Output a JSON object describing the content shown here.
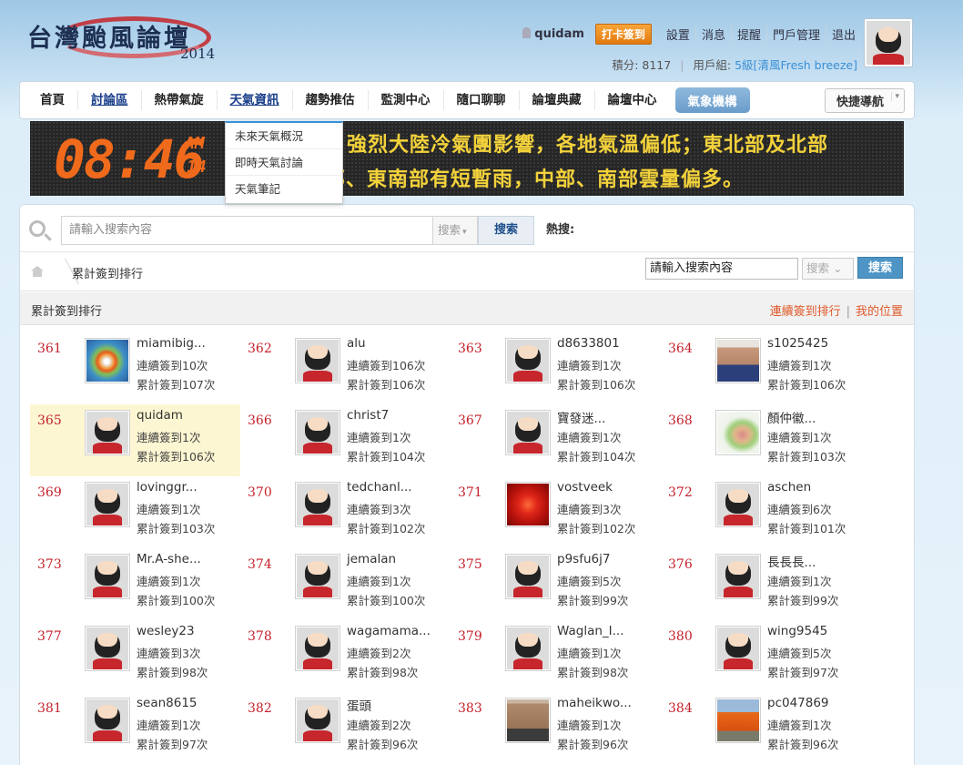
{
  "site": {
    "title": "台灣颱風論壇",
    "year": "2014"
  },
  "usermenu": {
    "username": "quidam",
    "checkin": "打卡簽到",
    "links": [
      "設置",
      "消息",
      "提醒",
      "門戶管理",
      "退出"
    ]
  },
  "userstats": {
    "points_label": "積分: 8117",
    "group_label": "用戶組:",
    "group_value": "5級[清風Fresh breeze]"
  },
  "nav": {
    "items": [
      "首頁",
      "討論區",
      "熱帶氣旋",
      "天氣資訊",
      "趨勢推估",
      "監測中心",
      "隨口聊聊",
      "論壇典藏",
      "論壇中心"
    ],
    "weather_button": "氣象機構",
    "quick_nav": "快捷導航"
  },
  "dropdown": {
    "items": [
      "未來天氣概況",
      "即時天氣討論",
      "天氣筆記"
    ]
  },
  "ticker": {
    "time": "08:46",
    "ampm": "AM",
    "day": "14",
    "line1": "強烈大陸冷氣團影響，各地氣溫偏低；東北部及北部",
    "line2": "部、東南部有短暫雨，中部、南部雲量偏多。"
  },
  "search": {
    "placeholder": "請輸入搜索內容",
    "select": "搜索",
    "button": "搜索",
    "hot": "熱搜:"
  },
  "breadcrumb": {
    "current": "累計簽到排行",
    "search_value": "請輸入搜索內容",
    "select": "搜索",
    "button": "搜索"
  },
  "section": {
    "title": "累計簽到排行",
    "link1": "連續簽到排行",
    "sep": "|",
    "link2": "我的位置"
  },
  "colors": {
    "accent": "#3a8fd6",
    "rank": "#c4202a",
    "highlight": "#fdf6d2",
    "ticker_text": "#f3d23b",
    "clock": "#f06a1c"
  },
  "ranking": [
    {
      "rank": "361",
      "name": "miamibig...",
      "streak": "連續簽到10次",
      "total": "累計簽到107次",
      "avatar": "hurricane-avatar"
    },
    {
      "rank": "362",
      "name": "alu",
      "streak": "連續簽到106次",
      "total": "累計簽到106次",
      "avatar": "default-avatar"
    },
    {
      "rank": "363",
      "name": "d8633801",
      "streak": "連續簽到1次",
      "total": "累計簽到106次",
      "avatar": "default-avatar"
    },
    {
      "rank": "364",
      "name": "s1025425",
      "streak": "連續簽到1次",
      "total": "累計簽到106次",
      "avatar": "photo-avatar"
    },
    {
      "rank": "365",
      "name": "quidam",
      "streak": "連續簽到1次",
      "total": "累計簽到106次",
      "avatar": "default-avatar"
    },
    {
      "rank": "366",
      "name": "christ7",
      "streak": "連續簽到1次",
      "total": "累計簽到104次",
      "avatar": "default-avatar"
    },
    {
      "rank": "367",
      "name": "寶發迷...",
      "streak": "連續簽到1次",
      "total": "累計簽到104次",
      "avatar": "default-avatar"
    },
    {
      "rank": "368",
      "name": "顏仲徽...",
      "streak": "連續簽到1次",
      "total": "累計簽到103次",
      "avatar": "map-avatar"
    },
    {
      "rank": "369",
      "name": "lovinggr...",
      "streak": "連續簽到1次",
      "total": "累計簽到103次",
      "avatar": "default-avatar"
    },
    {
      "rank": "370",
      "name": "tedchanl...",
      "streak": "連續簽到3次",
      "total": "累計簽到102次",
      "avatar": "default-avatar"
    },
    {
      "rank": "371",
      "name": "vostveek",
      "streak": "連續簽到3次",
      "total": "累計簽到102次",
      "avatar": "flower-avatar"
    },
    {
      "rank": "372",
      "name": "aschen",
      "streak": "連續簽到6次",
      "total": "累計簽到101次",
      "avatar": "default-avatar"
    },
    {
      "rank": "373",
      "name": "Mr.A-she...",
      "streak": "連續簽到1次",
      "total": "累計簽到100次",
      "avatar": "default-avatar"
    },
    {
      "rank": "374",
      "name": "jemalan",
      "streak": "連續簽到1次",
      "total": "累計簽到100次",
      "avatar": "default-avatar"
    },
    {
      "rank": "375",
      "name": "p9sfu6j7",
      "streak": "連續簽到5次",
      "total": "累計簽到99次",
      "avatar": "default-avatar"
    },
    {
      "rank": "376",
      "name": "長長長...",
      "streak": "連續簽到1次",
      "total": "累計簽到99次",
      "avatar": "default-avatar"
    },
    {
      "rank": "377",
      "name": "wesley23",
      "streak": "連續簽到3次",
      "total": "累計簽到98次",
      "avatar": "default-avatar"
    },
    {
      "rank": "378",
      "name": "wagamama...",
      "streak": "連續簽到2次",
      "total": "累計簽到98次",
      "avatar": "default-avatar"
    },
    {
      "rank": "379",
      "name": "Waglan_I...",
      "streak": "連續簽到1次",
      "total": "累計簽到98次",
      "avatar": "default-avatar"
    },
    {
      "rank": "380",
      "name": "wing9545",
      "streak": "連續簽到5次",
      "total": "累計簽到97次",
      "avatar": "default-avatar"
    },
    {
      "rank": "381",
      "name": "sean8615",
      "streak": "連續簽到1次",
      "total": "累計簽到97次",
      "avatar": "default-avatar"
    },
    {
      "rank": "382",
      "name": "蛋頭",
      "streak": "連續簽到2次",
      "total": "累計簽到96次",
      "avatar": "default-avatar"
    },
    {
      "rank": "383",
      "name": "maheikwo...",
      "streak": "連續簽到1次",
      "total": "累計簽到96次",
      "avatar": "photo-avatar"
    },
    {
      "rank": "384",
      "name": "pc047869",
      "streak": "連續簽到1次",
      "total": "累計簽到96次",
      "avatar": "photo-avatar"
    }
  ]
}
